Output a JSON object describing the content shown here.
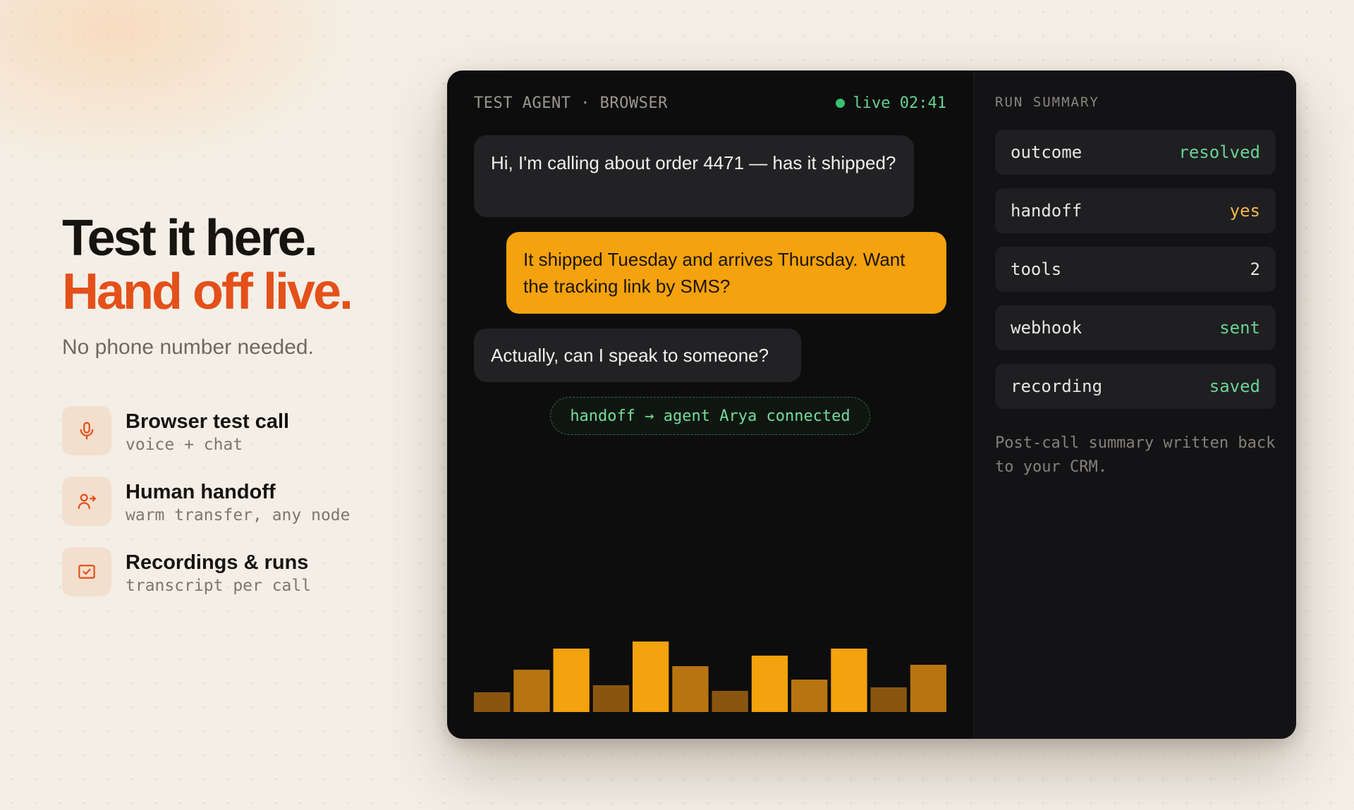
{
  "hero": {
    "line1": "Test it here.",
    "line2": "Hand off live.",
    "subtitle": "No phone number needed."
  },
  "features": [
    {
      "icon": "microphone-icon",
      "title": "Browser test call",
      "meta": "voice + chat"
    },
    {
      "icon": "user-transfer-icon",
      "title": "Human handoff",
      "meta": "warm transfer, any node"
    },
    {
      "icon": "recording-check-icon",
      "title": "Recordings & runs",
      "meta": "transcript per call"
    }
  ],
  "chat": {
    "header_title": "TEST AGENT · BROWSER",
    "live_label": "live 02:41",
    "messages": [
      {
        "role": "caller",
        "text": "Hi, I'm calling about order 4471 — has it shipped?"
      },
      {
        "role": "agent",
        "text": "It shipped Tuesday and arrives Thursday. Want the tracking link by SMS?"
      },
      {
        "role": "caller",
        "text": "Actually, can I speak to someone?"
      }
    ],
    "handoff_notice": "handoff → agent Arya connected",
    "waveform": {
      "levels": [
        0.28,
        0.6,
        0.9,
        0.38,
        1.0,
        0.65,
        0.3,
        0.8,
        0.46,
        0.9,
        0.35,
        0.67
      ],
      "colors": {
        "bright": "#f4a20d",
        "mid": "#b87410",
        "dim": "#8a560f"
      },
      "shades": [
        "dim",
        "mid",
        "bright",
        "dim",
        "bright",
        "mid",
        "dim",
        "bright",
        "mid",
        "bright",
        "dim",
        "mid"
      ]
    }
  },
  "summary": {
    "title": "RUN SUMMARY",
    "rows": [
      {
        "key": "outcome",
        "value": "resolved",
        "tone": "green"
      },
      {
        "key": "handoff",
        "value": "yes",
        "tone": "yellow"
      },
      {
        "key": "tools",
        "value": "2",
        "tone": "white"
      },
      {
        "key": "webhook",
        "value": "sent",
        "tone": "green"
      },
      {
        "key": "recording",
        "value": "saved",
        "tone": "green"
      }
    ],
    "note": "Post-call summary written back to your CRM."
  },
  "colors": {
    "accent": "#e4501a",
    "agent_bubble": "#f4a20d",
    "live_green": "#37c36e"
  }
}
